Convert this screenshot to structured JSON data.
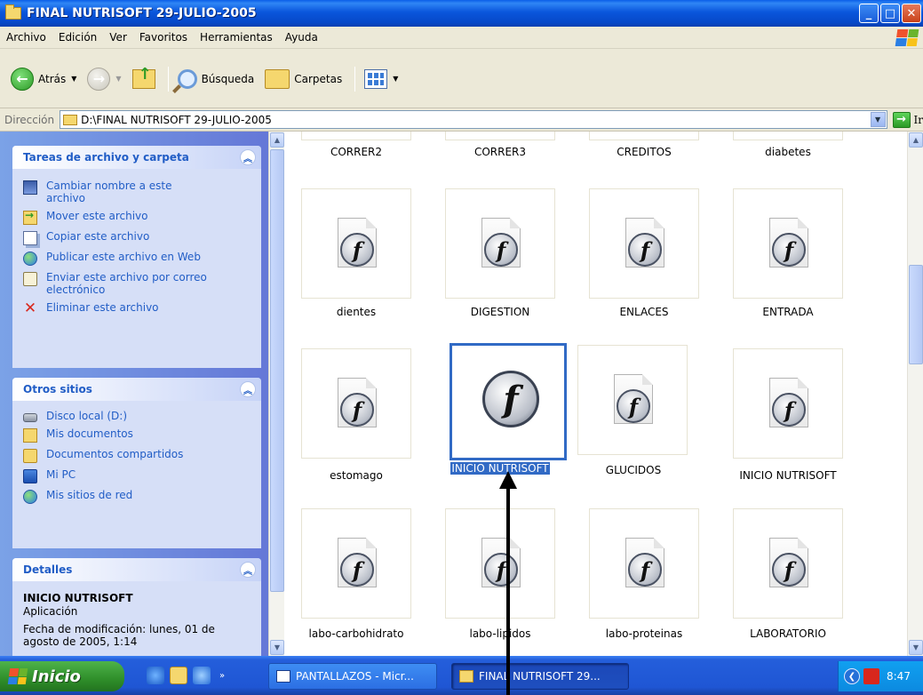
{
  "window": {
    "title": "FINAL NUTRISOFT 29-JULIO-2005",
    "controls": [
      "minimize",
      "maximize",
      "close"
    ]
  },
  "menu": [
    "Archivo",
    "Edición",
    "Ver",
    "Favoritos",
    "Herramientas",
    "Ayuda"
  ],
  "toolbar": {
    "back_label": "Atrás",
    "search_label": "Búsqueda",
    "folders_label": "Carpetas"
  },
  "address": {
    "label": "Dirección",
    "value": "D:\\FINAL NUTRISOFT 29-JULIO-2005",
    "go_label": "Ir"
  },
  "tasks_panel": {
    "title": "Tareas de archivo y carpeta",
    "items": [
      "Cambiar nombre a este archivo",
      "Mover este archivo",
      "Copiar este archivo",
      "Publicar este archivo en Web",
      "Enviar este archivo por correo electrónico",
      "Eliminar este archivo"
    ]
  },
  "places_panel": {
    "title": "Otros sitios",
    "items": [
      "Disco local (D:)",
      "Mis documentos",
      "Documentos compartidos",
      "Mi PC",
      "Mis sitios de red"
    ]
  },
  "details_panel": {
    "title": "Detalles",
    "name": "INICIO NUTRISOFT",
    "type": "Aplicación",
    "modified": "Fecha de modificación: lunes, 01 de agosto de 2005, 1:14"
  },
  "files": {
    "row0": [
      "CORRER2",
      "CORRER3",
      "CREDITOS",
      "diabetes"
    ],
    "row1": [
      "dientes",
      "DIGESTION",
      "ENLACES",
      "ENTRADA"
    ],
    "row2": [
      "estomago",
      "INICIO NUTRISOFT",
      "GLUCIDOS",
      "INICIO NUTRISOFT"
    ],
    "row3": [
      "labo-carbohidrato",
      "labo-lipidos",
      "labo-proteinas",
      "LABORATORIO"
    ],
    "selected": "INICIO NUTRISOFT"
  },
  "taskbar": {
    "start_label": "Inicio",
    "buttons": [
      "PANTALLAZOS - Micr...",
      "FINAL NUTRISOFT 29..."
    ],
    "clock": "8:47"
  },
  "colors": {
    "selection": "#316ac5",
    "titlebar": "#0a56dc",
    "taskpane": "#7ba2e7"
  }
}
